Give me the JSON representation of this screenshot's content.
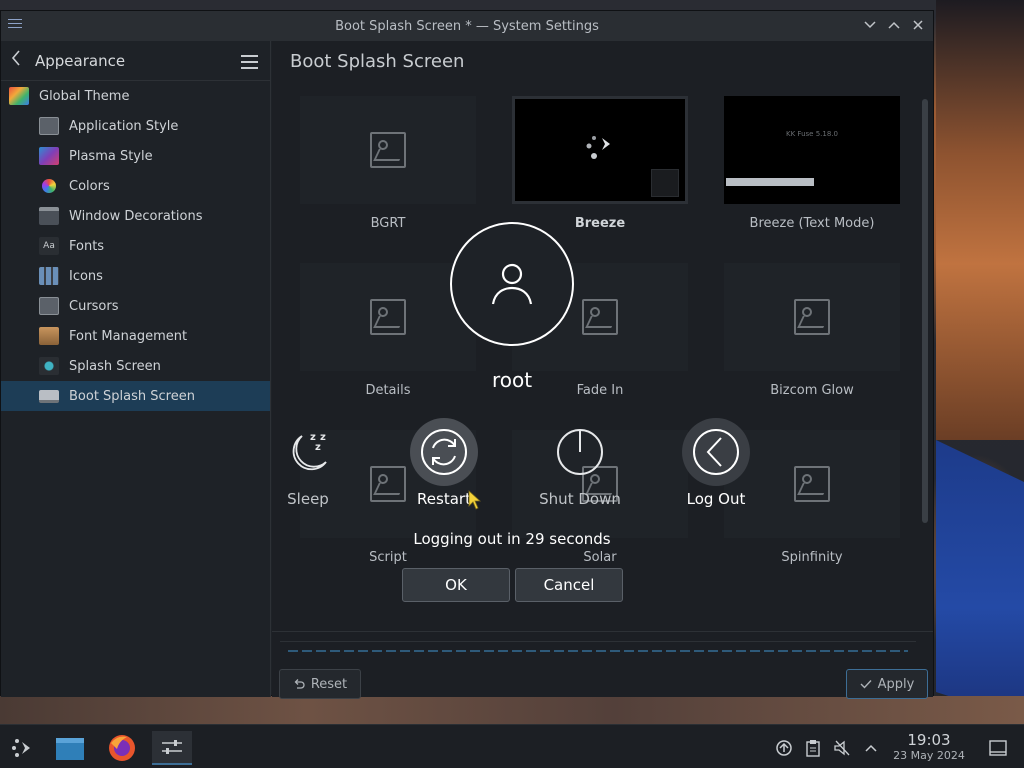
{
  "window": {
    "title": "Boot Splash Screen * — System Settings"
  },
  "sidebar": {
    "back_label": "Appearance",
    "items": [
      {
        "label": "Global Theme",
        "icon": "global-theme-icon",
        "level": "top"
      },
      {
        "label": "Application Style",
        "icon": "application-style-icon",
        "level": "child"
      },
      {
        "label": "Plasma Style",
        "icon": "plasma-style-icon",
        "level": "child"
      },
      {
        "label": "Colors",
        "icon": "colors-icon",
        "level": "child"
      },
      {
        "label": "Window Decorations",
        "icon": "window-decorations-icon",
        "level": "child"
      },
      {
        "label": "Fonts",
        "icon": "fonts-icon",
        "level": "child"
      },
      {
        "label": "Icons",
        "icon": "icons-icon",
        "level": "child"
      },
      {
        "label": "Cursors",
        "icon": "cursors-icon",
        "level": "child"
      },
      {
        "label": "Font Management",
        "icon": "font-management-icon",
        "level": "child"
      },
      {
        "label": "Splash Screen",
        "icon": "splash-screen-icon",
        "level": "child"
      },
      {
        "label": "Boot Splash Screen",
        "icon": "boot-splash-screen-icon",
        "level": "child",
        "selected": true
      }
    ]
  },
  "main": {
    "page_title": "Boot Splash Screen",
    "themes": [
      {
        "label": "BGRT"
      },
      {
        "label": "Breeze",
        "selected": true
      },
      {
        "label": "Breeze (Text Mode)",
        "preview_text": "KK Fuse 5.18.0"
      },
      {
        "label": "Details"
      },
      {
        "label": "Fade In"
      },
      {
        "label": "Bizcom Glow"
      },
      {
        "label": "Script"
      },
      {
        "label": "Solar"
      },
      {
        "label": "Spinfinity"
      }
    ],
    "reset_label": "Reset",
    "apply_label": "Apply"
  },
  "logout_dialog": {
    "username": "root",
    "actions": [
      {
        "label": "Sleep",
        "icon": "sleep-icon"
      },
      {
        "label": "Restart",
        "icon": "restart-icon"
      },
      {
        "label": "Shut Down",
        "icon": "shutdown-icon"
      },
      {
        "label": "Log Out",
        "icon": "logout-icon"
      }
    ],
    "countdown": "Logging out in 29 seconds",
    "ok_label": "OK",
    "cancel_label": "Cancel"
  },
  "taskbar": {
    "time": "19:03",
    "date": "23 May 2024"
  },
  "colors": {
    "accent": "#3d6e96",
    "selection": "#1d3d56"
  }
}
